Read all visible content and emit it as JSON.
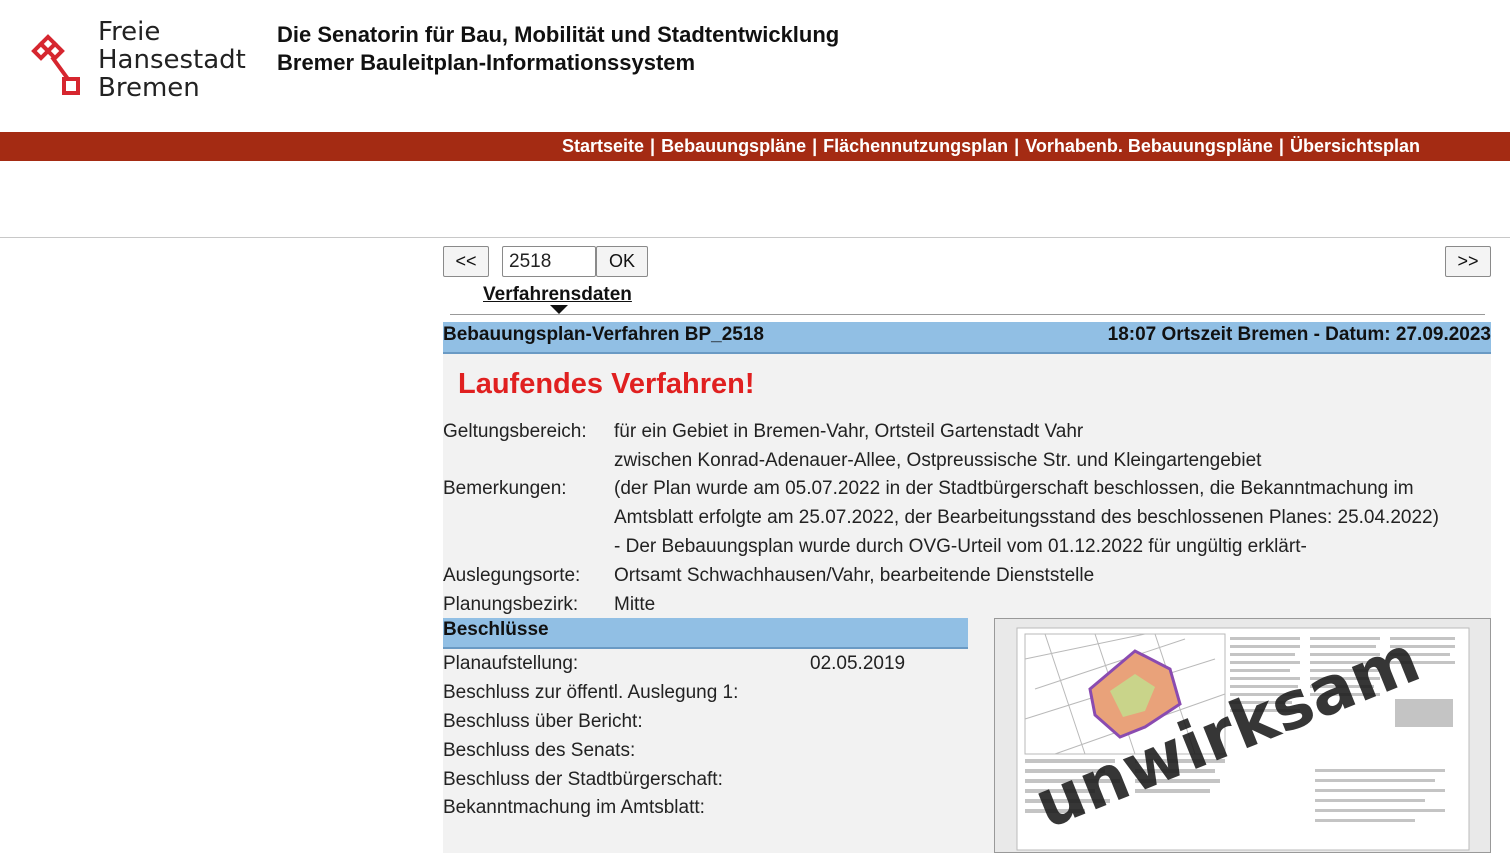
{
  "header": {
    "logo_lines": [
      "Freie",
      "Hansestadt",
      "Bremen"
    ],
    "title1": "Die Senatorin für Bau, Mobilität und Stadtentwicklung",
    "title2": "Bremer Bauleitplan-Informationssystem"
  },
  "nav": {
    "items": [
      "Startseite",
      "Bebauungspläne",
      "Flächennutzungsplan",
      "Vorhabenb. Bebauungspläne",
      "Übersichtsplan"
    ],
    "separator": "|"
  },
  "controls": {
    "prev_label": "<<",
    "next_label": ">>",
    "ok_label": "OK",
    "plan_number": "2518"
  },
  "tab": {
    "label": "Verfahrensdaten"
  },
  "section1": {
    "title": "Bebauungsplan-Verfahren BP_2518",
    "time": "18:07 Ortszeit Bremen - Datum: 27.09.2023"
  },
  "status": "Laufendes Verfahren!",
  "fields": {
    "geltungsbereich_label": "Geltungsbereich:",
    "geltungsbereich_line1": "für ein Gebiet in Bremen-Vahr, Ortsteil Gartenstadt Vahr",
    "geltungsbereich_line2": "zwischen Konrad-Adenauer-Allee, Ostpreussische Str. und Kleingartengebiet",
    "bemerkungen_label": "Bemerkungen:",
    "bemerkungen_line1": "(der Plan wurde am 05.07.2022 in der Stadtbürgerschaft beschlossen, die Bekanntmachung im",
    "bemerkungen_line2": "Amtsblatt erfolgte am 25.07.2022, der Bearbeitungsstand des beschlossenen Planes: 25.04.2022)",
    "bemerkungen_line3": "- Der Bebauungsplan wurde durch OVG-Urteil vom 01.12.2022 für ungültig erklärt-",
    "auslegungsorte_label": "Auslegungsorte:",
    "auslegungsorte_value": "Ortsamt Schwachhausen/Vahr, bearbeitende Dienststelle",
    "planungsbezirk_label": "Planungsbezirk:",
    "planungsbezirk_value": "Mitte"
  },
  "beschluesse": {
    "title": "Beschlüsse",
    "rows": [
      {
        "label": "Planaufstellung:",
        "value": "02.05.2019"
      },
      {
        "label": "Beschluss zur öffentl. Auslegung 1:",
        "value": ""
      },
      {
        "label": "Beschluss über Bericht:",
        "value": ""
      },
      {
        "label": "Beschluss des Senats:",
        "value": ""
      },
      {
        "label": "Beschluss der Stadtbürgerschaft:",
        "value": ""
      },
      {
        "label": "Bekanntmachung im Amtsblatt:",
        "value": ""
      }
    ]
  },
  "thumbnail": {
    "stamp": "unwirksam"
  },
  "colors": {
    "nav_bg": "#a42b13",
    "section_bar": "#91bfe4",
    "status_red": "#e02020",
    "logo_red": "#d6262f"
  }
}
